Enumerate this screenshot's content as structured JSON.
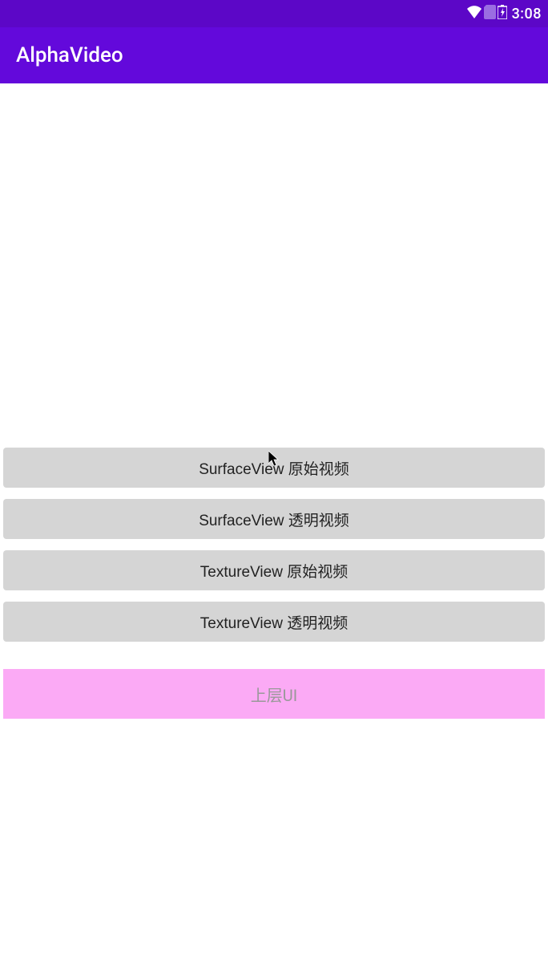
{
  "status": {
    "time": "3:08"
  },
  "appbar": {
    "title": "AlphaVideo"
  },
  "buttons": {
    "surfaceview_raw": "SurfaceView 原始视频",
    "surfaceview_alpha": "SurfaceView 透明视频",
    "textureview_raw": "TextureView 原始视频",
    "textureview_alpha": "TextureView 透明视频"
  },
  "overlay": {
    "label": "上层UI"
  },
  "colors": {
    "status_bar": "#5c07c7",
    "app_bar": "#6309db",
    "button_bg": "#d5d5d5",
    "pink_bg": "#fbaaf5"
  }
}
